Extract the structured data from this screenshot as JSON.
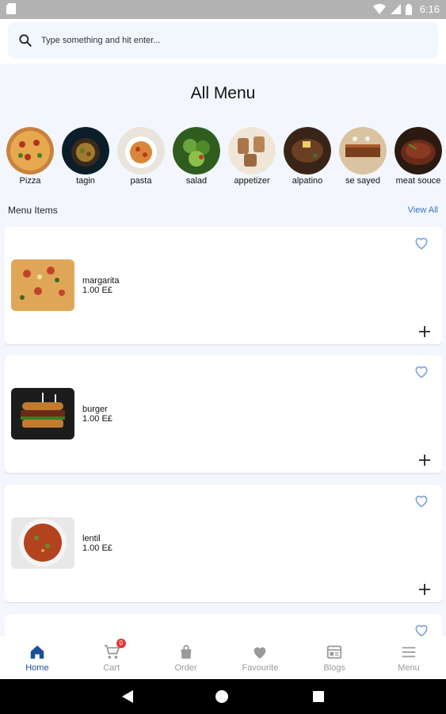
{
  "status_bar": {
    "time": "6:16"
  },
  "search": {
    "placeholder": "Type something and hit enter...",
    "value": ""
  },
  "page": {
    "title": "All Menu"
  },
  "categories": [
    {
      "label": "Pizza"
    },
    {
      "label": "tagin"
    },
    {
      "label": "pasta"
    },
    {
      "label": "salad"
    },
    {
      "label": "appetizer"
    },
    {
      "label": "alpatino"
    },
    {
      "label": "se sayed"
    },
    {
      "label": "meat souce"
    }
  ],
  "menu_section": {
    "title": "Menu Items",
    "view_all": "View All"
  },
  "menu_items": [
    {
      "name": "margarita",
      "price": "1.00 E£"
    },
    {
      "name": "burger",
      "price": "1.00 E£"
    },
    {
      "name": "lentil",
      "price": "1.00 E£"
    }
  ],
  "bottom_nav": [
    {
      "label": "Home",
      "icon": "home-icon",
      "active": true
    },
    {
      "label": "Cart",
      "icon": "cart-icon",
      "badge": "0"
    },
    {
      "label": "Order",
      "icon": "bag-icon"
    },
    {
      "label": "Favourite",
      "icon": "heart-icon"
    },
    {
      "label": "Blogs",
      "icon": "blog-icon"
    },
    {
      "label": "Menu",
      "icon": "menu-icon"
    }
  ],
  "colors": {
    "accent": "#1a4f9c",
    "link": "#3d6fb6",
    "heart": "#7ea6dc",
    "badge": "#e53935"
  }
}
